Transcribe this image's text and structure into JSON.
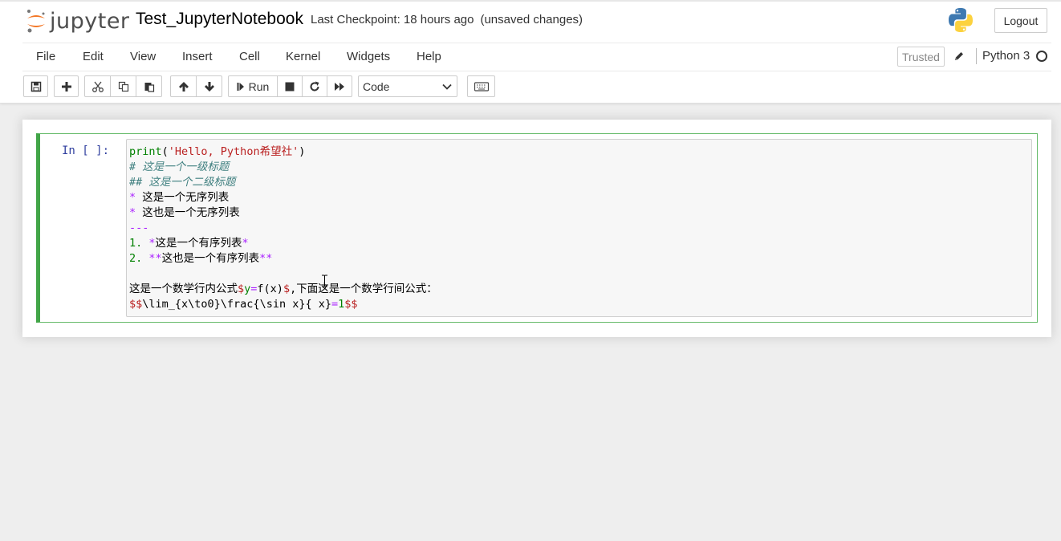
{
  "header": {
    "logo_text": "jupyter",
    "notebook_name": "Test_JupyterNotebook",
    "checkpoint": "Last Checkpoint: 18 hours ago",
    "save_status": "(unsaved changes)",
    "logout_label": "Logout"
  },
  "menu": {
    "items": [
      "File",
      "Edit",
      "View",
      "Insert",
      "Cell",
      "Kernel",
      "Widgets",
      "Help"
    ]
  },
  "kernel": {
    "trusted_label": "Trusted",
    "name": "Python 3"
  },
  "toolbar": {
    "run_label": "Run",
    "cell_type": "Code"
  },
  "cell": {
    "prompt": "In [ ]:",
    "lines": [
      "print('Hello, Python希望社')",
      "# 这是一个一级标题",
      "## 这是一个二级标题",
      "* 这是一个无序列表",
      "* 这也是一个无序列表",
      "---",
      "1. *这是一个有序列表*",
      "2. **这也是一个有序列表**",
      "",
      "这是一个数学行内公式$y=f(x)$,下面这是一个数学行间公式：",
      "$$\\lim_{x\\to0}\\frac{\\sin x}{ x}=1$$"
    ]
  },
  "colors": {
    "cell_border": "#66bb6a",
    "prompt": "#303f9f",
    "keyword": "#008000",
    "string": "#ba2121",
    "comment": "#408080",
    "markup": "#aa22ff"
  }
}
